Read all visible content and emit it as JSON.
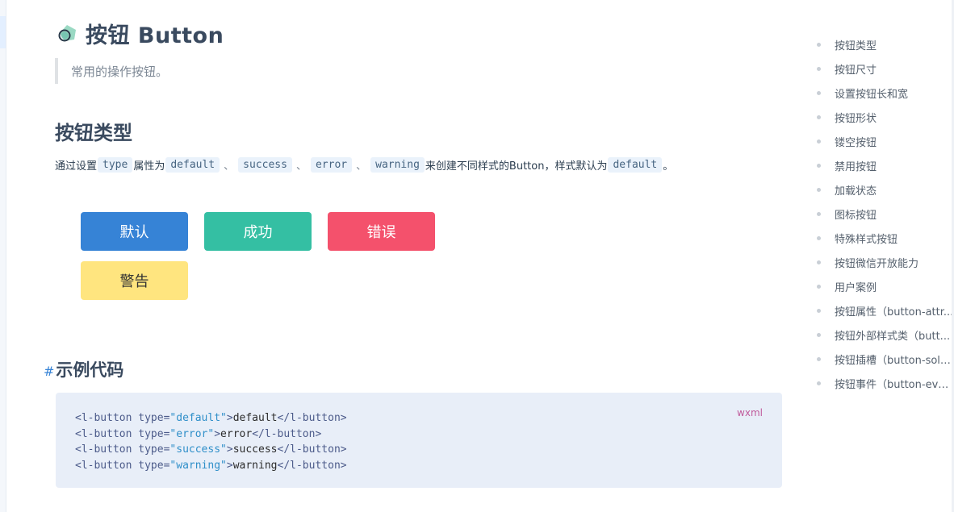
{
  "page": {
    "title": "按钮 Button",
    "subtitle": "常用的操作按钮。",
    "section_title": "按钮类型",
    "description": {
      "p1": "通过设置",
      "c1": "type",
      "p2": "属性为",
      "c2": "default",
      "s1": "、",
      "c3": "success",
      "s2": "、",
      "c4": "error",
      "s3": "、",
      "c5": "warning",
      "p3": "来创建不同样式的Button，样式默认为",
      "c6": "default",
      "p4": "。"
    }
  },
  "demo_buttons": {
    "default": "默认",
    "success": "成功",
    "error": "错误",
    "warning": "警告"
  },
  "example": {
    "hash": "#",
    "title": "示例代码",
    "lang": "wxml",
    "lines": [
      {
        "open": "<l-button ",
        "attr": "type=",
        "val": "\"default\"",
        "close": ">",
        "text": "default",
        "end": "</l-button>"
      },
      {
        "open": "<l-button ",
        "attr": "type=",
        "val": "\"error\"",
        "close": ">",
        "text": "error",
        "end": "</l-button>"
      },
      {
        "open": "<l-button ",
        "attr": "type=",
        "val": "\"success\"",
        "close": ">",
        "text": "success",
        "end": "</l-button>"
      },
      {
        "open": "<l-button ",
        "attr": "type=",
        "val": "\"warning\"",
        "close": ">",
        "text": "warning",
        "end": "</l-button>"
      }
    ]
  },
  "toc": [
    "按钮类型",
    "按钮尺寸",
    "设置按钮长和宽",
    "按钮形状",
    "镂空按钮",
    "禁用按钮",
    "加载状态",
    "图标按钮",
    "特殊样式按钮",
    "按钮微信开放能力",
    "用户案例",
    "按钮属性（button-attr...",
    "按钮外部样式类（butt...",
    "按钮插槽（button-solt...",
    "按钮事件（button-eve..."
  ],
  "colors": {
    "default": "#3683d6",
    "success": "#34bfa3",
    "error": "#f4516c",
    "warning": "#ffe57f",
    "code_bg": "#e8eef8"
  },
  "icons": {
    "title_logo": "lin-ui-logo-icon"
  }
}
